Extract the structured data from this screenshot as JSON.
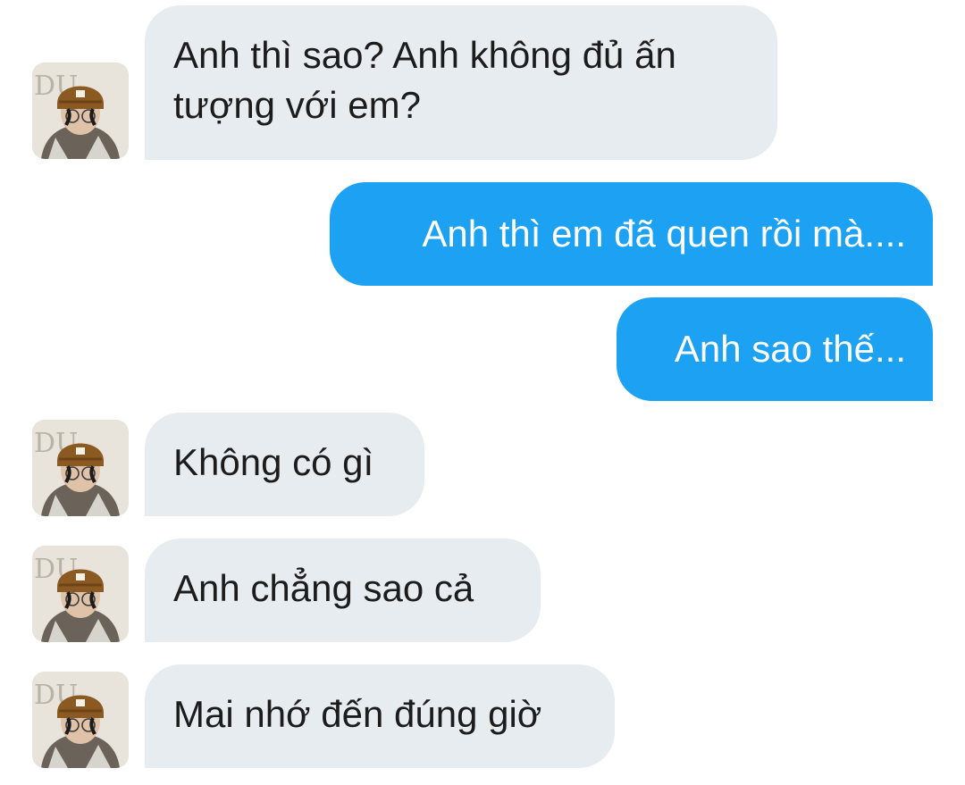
{
  "colors": {
    "incoming_bubble": "#e6ecf0",
    "outgoing_bubble": "#1da1f2",
    "incoming_text": "#1c1c1c",
    "outgoing_text": "#ffffff"
  },
  "avatar": {
    "icon": "profile-photo-avatar",
    "sign_text": "DU"
  },
  "messages": [
    {
      "from": "other",
      "lines": [
        "Anh thì sao? Anh không đủ ấn",
        "tượng với em?"
      ]
    },
    {
      "from": "me",
      "lines": [
        "Anh thì em đã quen rồi mà...."
      ]
    },
    {
      "from": "me",
      "lines": [
        "Anh sao thế..."
      ]
    },
    {
      "from": "other",
      "lines": [
        "Không có gì"
      ]
    },
    {
      "from": "other",
      "lines": [
        "Anh chẳng sao cả"
      ]
    },
    {
      "from": "other",
      "lines": [
        "Mai nhớ đến đúng giờ"
      ]
    }
  ]
}
